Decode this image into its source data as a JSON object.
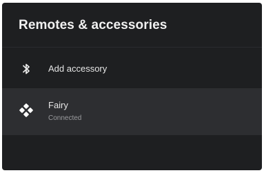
{
  "header": {
    "title": "Remotes & accessories"
  },
  "items": [
    {
      "icon": "bluetooth-icon",
      "label": "Add accessory"
    },
    {
      "icon": "gamepad-icon",
      "label": "Fairy",
      "status": "Connected"
    }
  ],
  "colors": {
    "panel_bg": "#1e1f21",
    "selected_row_bg": "#2d2e31",
    "text_primary": "#f1f1f1",
    "text_secondary": "#9a9b9e"
  }
}
